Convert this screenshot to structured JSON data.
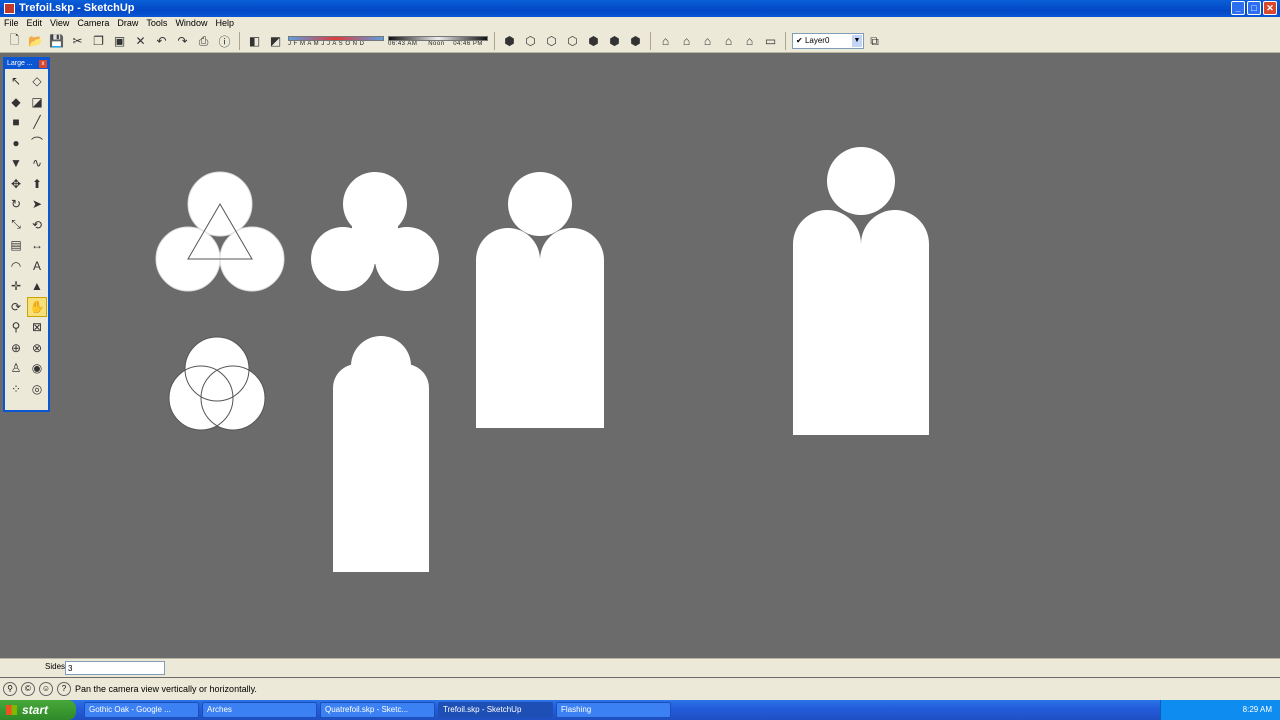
{
  "window": {
    "title": "Trefoil.skp - SketchUp",
    "minimize": "_",
    "maximize": "□",
    "close": "✕"
  },
  "menu": [
    "File",
    "Edit",
    "View",
    "Camera",
    "Draw",
    "Tools",
    "Window",
    "Help"
  ],
  "toolbar": {
    "month_scale": "J F M A M J J A S O N D",
    "time_early": "06:43 AM",
    "time_noon": "Noon",
    "time_late": "04:46 PM",
    "layer_check": "✔",
    "layer": "Layer0",
    "dropdown_arrow": "▼",
    "icons": [
      "new",
      "open",
      "save",
      "cut",
      "copy",
      "paste",
      "erase",
      "undo",
      "redo",
      "print",
      "model-info",
      "shadows",
      "fog"
    ]
  },
  "toolset": {
    "title": "Large ...",
    "close": "x",
    "tools": [
      {
        "name": "select-tool",
        "glyph": "↖"
      },
      {
        "name": "make-component-tool",
        "glyph": "◇"
      },
      {
        "name": "paint-bucket-tool",
        "glyph": "◆"
      },
      {
        "name": "eraser-tool",
        "glyph": "◪"
      },
      {
        "name": "rectangle-tool",
        "glyph": "■"
      },
      {
        "name": "line-tool",
        "glyph": "╱"
      },
      {
        "name": "circle-tool",
        "glyph": "●"
      },
      {
        "name": "arc-tool",
        "glyph": "⌒"
      },
      {
        "name": "polygon-tool",
        "glyph": "▼"
      },
      {
        "name": "freehand-tool",
        "glyph": "∿"
      },
      {
        "name": "move-tool",
        "glyph": "✥"
      },
      {
        "name": "push-pull-tool",
        "glyph": "⬆"
      },
      {
        "name": "rotate-tool",
        "glyph": "↻"
      },
      {
        "name": "follow-me-tool",
        "glyph": "➤"
      },
      {
        "name": "scale-tool",
        "glyph": "⤡"
      },
      {
        "name": "offset-tool",
        "glyph": "⟲"
      },
      {
        "name": "tape-measure-tool",
        "glyph": "▤"
      },
      {
        "name": "dimension-tool",
        "glyph": "↔"
      },
      {
        "name": "protractor-tool",
        "glyph": "◠"
      },
      {
        "name": "text-tool",
        "glyph": "A"
      },
      {
        "name": "axes-tool",
        "glyph": "✛"
      },
      {
        "name": "3d-text-tool",
        "glyph": "▲"
      },
      {
        "name": "orbit-tool",
        "glyph": "⟳"
      },
      {
        "name": "pan-tool",
        "glyph": "✋"
      },
      {
        "name": "zoom-tool",
        "glyph": "⚲"
      },
      {
        "name": "zoom-window-tool",
        "glyph": "⊠"
      },
      {
        "name": "zoom-extents-tool",
        "glyph": "⊕"
      },
      {
        "name": "previous-view-tool",
        "glyph": "⊗"
      },
      {
        "name": "position-camera-tool",
        "glyph": "♙"
      },
      {
        "name": "look-around-tool",
        "glyph": "◉"
      },
      {
        "name": "walk-tool",
        "glyph": "⁘"
      },
      {
        "name": "section-plane-tool",
        "glyph": "◎"
      }
    ]
  },
  "vcb": {
    "label": "Sides",
    "value": "3"
  },
  "status": {
    "message": "Pan the camera view vertically or horizontally.",
    "icons": [
      "geo",
      "credits",
      "user"
    ],
    "help_glyph": "?"
  },
  "taskbar": {
    "start": "start",
    "tasks": [
      "Gothic Oak - Google ...",
      "Arches",
      "Quatrefoil.skp - Sketc...",
      "Trefoil.skp - SketchUp",
      "Flashing"
    ],
    "active_task": 3,
    "clock": "8:29 AM"
  }
}
